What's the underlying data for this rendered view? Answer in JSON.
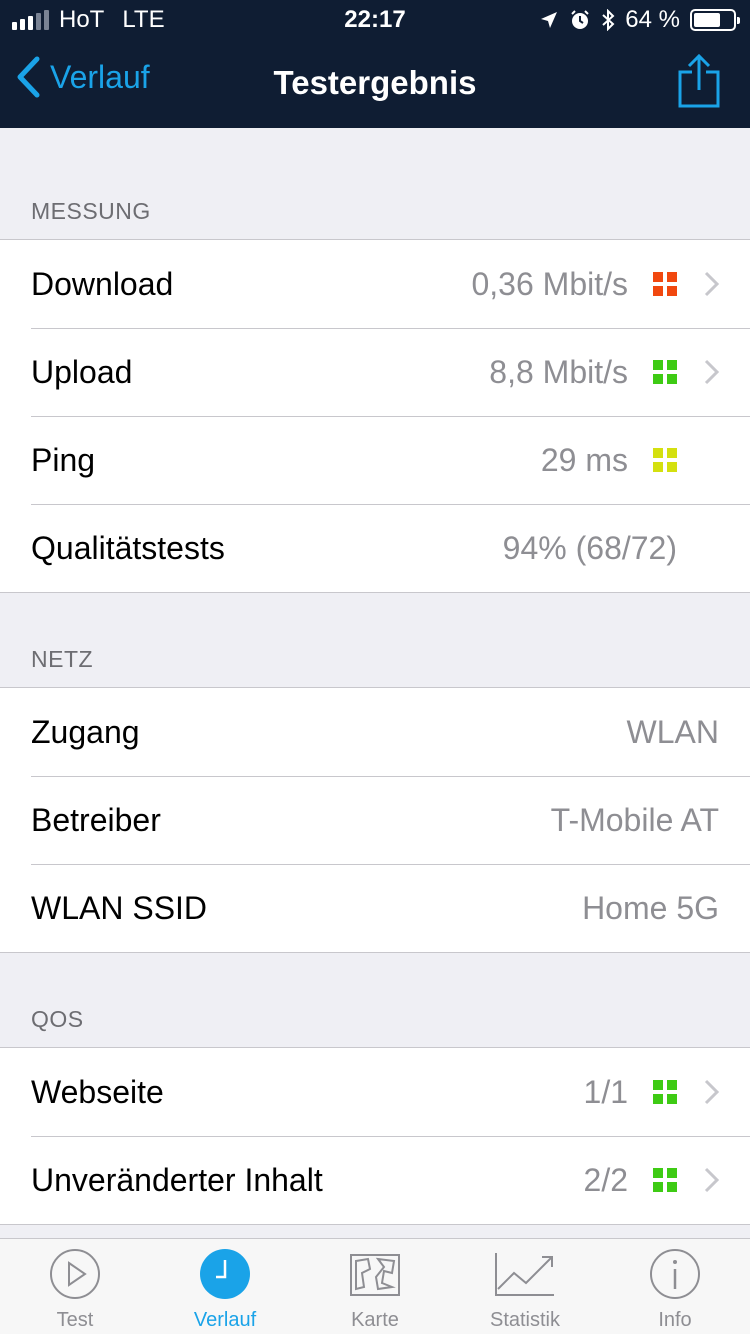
{
  "status_bar": {
    "carrier": "HoT",
    "network": "LTE",
    "time": "22:17",
    "battery": "64 %"
  },
  "nav": {
    "back_label": "Verlauf",
    "title": "Testergebnis"
  },
  "sections": {
    "messung": {
      "header": "MESSUNG",
      "rows": [
        {
          "label": "Download",
          "value": "0,36 Mbit/s"
        },
        {
          "label": "Upload",
          "value": "8,8 Mbit/s"
        },
        {
          "label": "Ping",
          "value": "29 ms"
        },
        {
          "label": "Qualitätstests",
          "value": "94% (68/72)"
        }
      ]
    },
    "netz": {
      "header": "NETZ",
      "rows": [
        {
          "label": "Zugang",
          "value": "WLAN"
        },
        {
          "label": "Betreiber",
          "value": "T-Mobile AT"
        },
        {
          "label": "WLAN SSID",
          "value": "Home 5G"
        }
      ]
    },
    "qos": {
      "header": "QOS",
      "rows": [
        {
          "label": "Webseite",
          "value": "1/1"
        },
        {
          "label": "Unveränderter Inhalt",
          "value": "2/2"
        }
      ]
    }
  },
  "indicator_colors": {
    "red": "#f1480f",
    "green": "#3ecb14",
    "yellow": "#d4e00f"
  },
  "tabbar": {
    "tabs": [
      {
        "label": "Test",
        "icon": "play-icon"
      },
      {
        "label": "Verlauf",
        "icon": "clock-icon"
      },
      {
        "label": "Karte",
        "icon": "map-icon"
      },
      {
        "label": "Statistik",
        "icon": "chart-icon"
      },
      {
        "label": "Info",
        "icon": "info-icon"
      }
    ],
    "active": "Verlauf"
  }
}
